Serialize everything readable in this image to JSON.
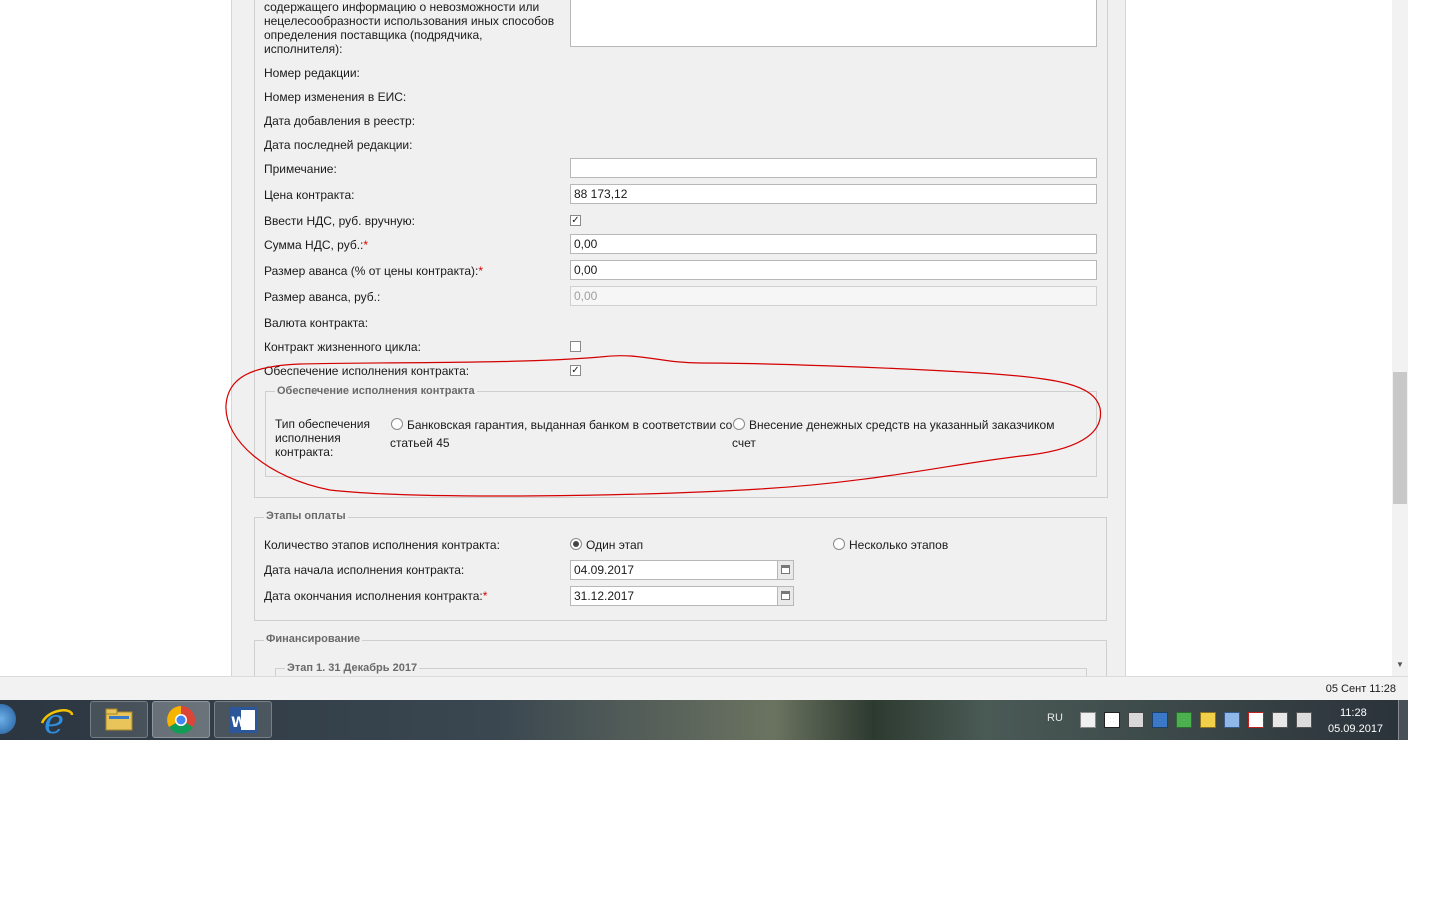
{
  "form": {
    "justification_text": [
      "содержащего информацию о невозможности или",
      "нецелесообразности использования иных способов",
      "определения поставщика (подрядчика,",
      "исполнителя):"
    ],
    "edition_number_label": "Номер редакции:",
    "eis_change_number_label": "Номер изменения в ЕИС:",
    "registry_date_label": "Дата добавления в реестр:",
    "last_edition_date_label": "Дата последней редакции:",
    "note_label": "Примечание:",
    "note_value": "",
    "contract_price_label": "Цена контракта:",
    "contract_price_value": "88 173,12",
    "manual_vat_label": "Ввести НДС, руб. вручную:",
    "manual_vat_checked": true,
    "vat_sum_label": "Сумма НДС, руб.:",
    "vat_sum_value": "0,00",
    "advance_percent_label": "Размер аванса (% от цены контракта):",
    "advance_percent_value": "0,00",
    "advance_rub_label": "Размер аванса, руб.:",
    "advance_rub_value": "0,00",
    "currency_label": "Валюта контракта:",
    "lifecycle_label": "Контракт жизненного цикла:",
    "lifecycle_checked": false,
    "security_label": "Обеспечение исполнения контракта:",
    "security_checked": true,
    "required_mark": "*"
  },
  "security_section": {
    "legend": "Обеспечение исполнения контракта",
    "type_label": [
      "Тип обеспечения",
      "исполнения",
      "контракта:"
    ],
    "option_bank": [
      "Банковская гарантия, выданная банком в соответствии со",
      "статьей 45"
    ],
    "option_money": [
      "Внесение денежных средств на указанный заказчиком",
      "счет"
    ]
  },
  "payment_section": {
    "legend": "Этапы оплаты",
    "stages_count_label": "Количество этапов исполнения контракта:",
    "option_one": "Один этап",
    "option_many": "Несколько этапов",
    "start_date_label": "Дата начала исполнения контракта:",
    "start_date_value": "04.09.2017",
    "end_date_label": "Дата окончания исполнения контракта:",
    "end_date_value": "31.12.2017"
  },
  "financing_section": {
    "legend": "Финансирование",
    "stage_legend": "Этап 1. 31 Декабрь 2017"
  },
  "statusbar": {
    "datetime": "05 Сент 11:28"
  },
  "taskbar": {
    "language": "RU",
    "time": "11:28",
    "date": "05.09.2017"
  },
  "colors": {
    "annotation": "#d40000",
    "panel_bg": "#f0f0f0",
    "required": "#e00000"
  }
}
